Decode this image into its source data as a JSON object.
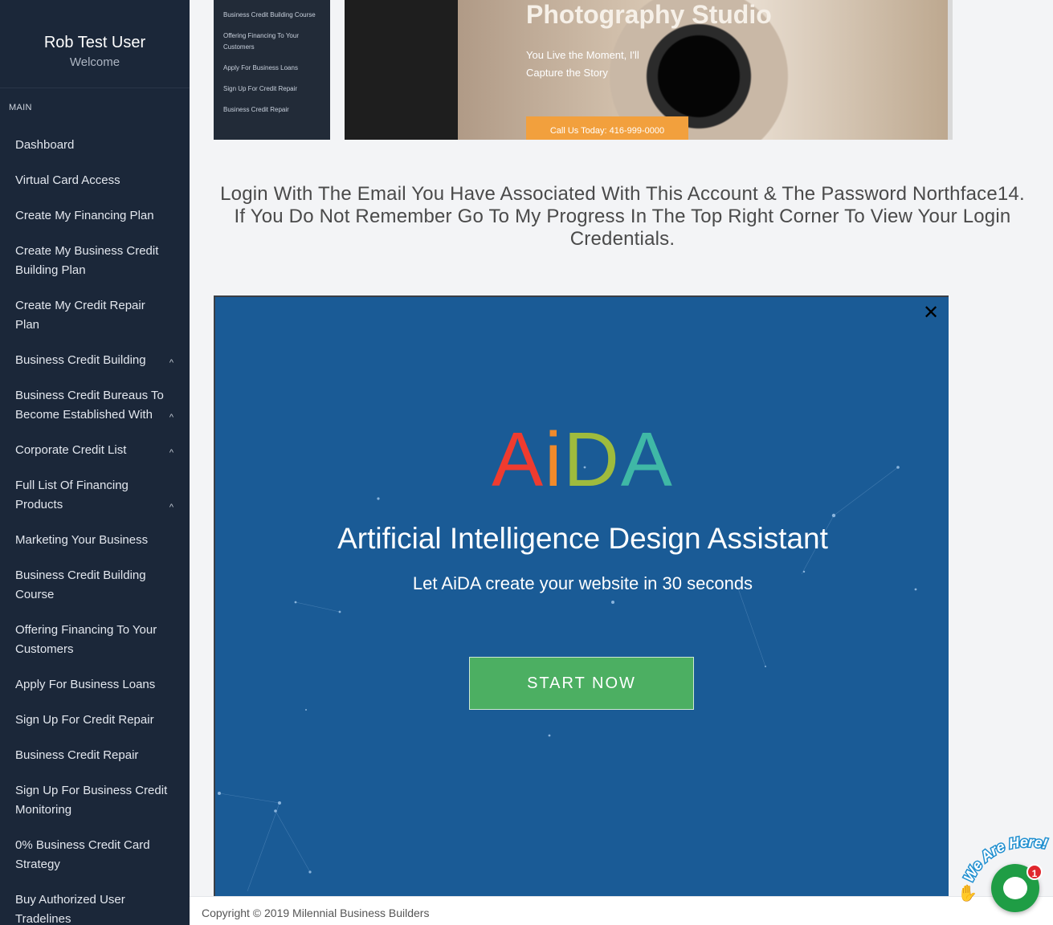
{
  "profile": {
    "name": "Rob Test User",
    "welcome": "Welcome"
  },
  "sidebar": {
    "section_label": "MAIN",
    "items": [
      {
        "label": "Dashboard",
        "chevron": false
      },
      {
        "label": "Virtual Card Access",
        "chevron": false
      },
      {
        "label": "Create My Financing Plan",
        "chevron": false
      },
      {
        "label": "Create My Business Credit Building Plan",
        "chevron": false
      },
      {
        "label": "Create My Credit Repair Plan",
        "chevron": false
      },
      {
        "label": "Business Credit Building",
        "chevron": true
      },
      {
        "label": "Business Credit Bureaus To Become Established With",
        "chevron": true
      },
      {
        "label": "Corporate Credit List",
        "chevron": true
      },
      {
        "label": "Full List Of Financing Products",
        "chevron": true
      },
      {
        "label": "Marketing Your Business",
        "chevron": false
      },
      {
        "label": "Business Credit Building Course",
        "chevron": false
      },
      {
        "label": "Offering Financing To Your Customers",
        "chevron": false
      },
      {
        "label": "Apply For Business Loans",
        "chevron": false
      },
      {
        "label": "Sign Up For Credit Repair",
        "chevron": false
      },
      {
        "label": "Business Credit Repair",
        "chevron": false
      },
      {
        "label": "Sign Up For Business Credit Monitoring",
        "chevron": false
      },
      {
        "label": "0% Business Credit Card Strategy",
        "chevron": false
      },
      {
        "label": "Buy Authorized User Tradelines",
        "chevron": false
      }
    ]
  },
  "hero": {
    "menu_items": [
      "Business Credit Building Course",
      "Offering Financing To Your Customers",
      "Apply For Business Loans",
      "Sign Up For Credit Repair",
      "Business Credit Repair"
    ],
    "title": "Photography Studio",
    "subtitle": "You Live the Moment, I'll Capture the Story",
    "cta": "Call Us Today: 416-999-0000"
  },
  "notice": "Login With The Email You Have Associated With This Account & The Password Northface14. If You Do Not Remember Go To My Progress In The Top Right Corner To View Your Login Credentials.",
  "popup": {
    "logo_letters": [
      "A",
      "i",
      "D",
      "A"
    ],
    "title": "Artificial Intelligence Design Assistant",
    "subtitle": "Let AiDA create your website in 30 seconds",
    "button": "START NOW",
    "close": "✕"
  },
  "footer": {
    "copyright": "Copyright © 2019 Milennial Business Builders"
  },
  "chat": {
    "badge_text": "We Are Here!",
    "count": "1"
  },
  "colors": {
    "sidebar": "#1b2739",
    "popup": "#1a5b96",
    "start_button": "#4caf62",
    "chat": "#1f9d45"
  }
}
